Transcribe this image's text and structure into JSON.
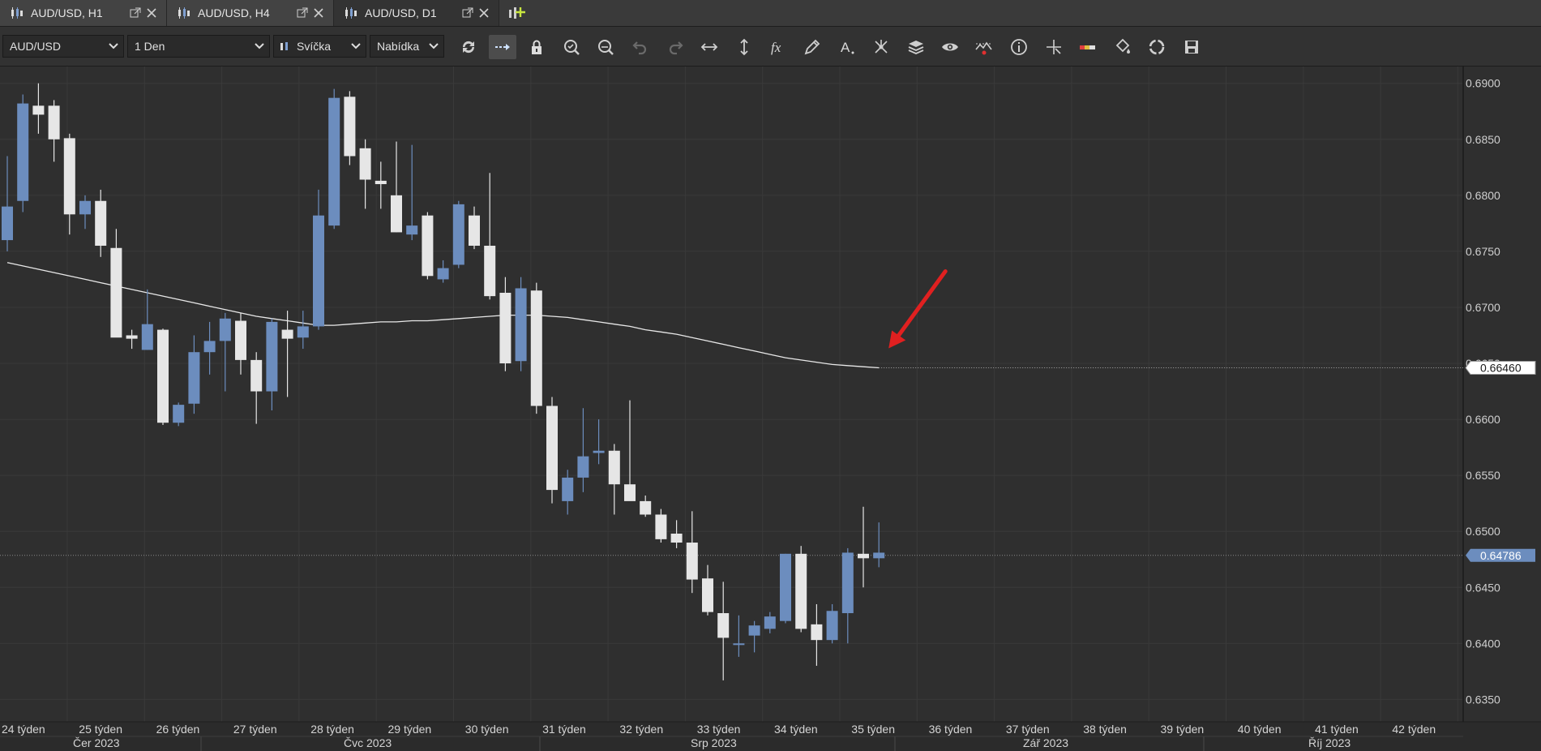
{
  "tabs": [
    {
      "label": "AUD/USD, H1",
      "active": false
    },
    {
      "label": "AUD/USD, H4",
      "active": false
    },
    {
      "label": "AUD/USD, D1",
      "active": true
    }
  ],
  "toolbar": {
    "symbol": "AUD/USD",
    "period": "1 Den",
    "chart_type": "Svíčka",
    "price_side": "Nabídka",
    "icons": [
      "refresh-icon",
      "autoscroll-icon",
      "lock-icon",
      "zoom-in-icon",
      "zoom-out-icon",
      "undo-icon",
      "redo-icon",
      "horizontal-arrows-icon",
      "vertical-arrows-icon",
      "indicators-fx-icon",
      "pencil-icon",
      "text-tool-icon",
      "pattern-icon",
      "layers-icon",
      "eye-icon",
      "alert-icon",
      "info-icon",
      "crosshair-icon",
      "color-bar-icon",
      "paint-bucket-icon",
      "reload-template-icon",
      "save-icon"
    ]
  },
  "colors": {
    "bull": "#6c8dbe",
    "bear": "#e6e6e6",
    "bg": "#2f2f2f",
    "grid": "#3a3a3a",
    "ma": "#e8e8e8",
    "arrow": "#e02020",
    "price_tag": "#6c8dbe"
  },
  "chart_data": {
    "type": "candlestick",
    "ylim": [
      0.633,
      0.6915
    ],
    "yticks": [
      "0.6900",
      "0.6850",
      "0.6800",
      "0.6750",
      "0.6700",
      "0.6650",
      "0.6600",
      "0.6550",
      "0.6500",
      "0.6450",
      "0.6400",
      "0.6350"
    ],
    "candles": [
      {
        "o": 0.676,
        "h": 0.6835,
        "l": 0.675,
        "c": 0.679
      },
      {
        "o": 0.6795,
        "h": 0.689,
        "l": 0.6785,
        "c": 0.6882
      },
      {
        "o": 0.688,
        "h": 0.69,
        "l": 0.6855,
        "c": 0.6872
      },
      {
        "o": 0.688,
        "h": 0.6885,
        "l": 0.683,
        "c": 0.685
      },
      {
        "o": 0.6851,
        "h": 0.6855,
        "l": 0.6765,
        "c": 0.6783
      },
      {
        "o": 0.6783,
        "h": 0.68,
        "l": 0.677,
        "c": 0.6795
      },
      {
        "o": 0.6795,
        "h": 0.6805,
        "l": 0.6745,
        "c": 0.6755
      },
      {
        "o": 0.6753,
        "h": 0.677,
        "l": 0.6705,
        "c": 0.6673
      },
      {
        "o": 0.6675,
        "h": 0.668,
        "l": 0.6663,
        "c": 0.6672
      },
      {
        "o": 0.6662,
        "h": 0.6716,
        "l": 0.6662,
        "c": 0.6685
      },
      {
        "o": 0.668,
        "h": 0.6681,
        "l": 0.6595,
        "c": 0.6597
      },
      {
        "o": 0.6597,
        "h": 0.6615,
        "l": 0.6594,
        "c": 0.6613
      },
      {
        "o": 0.6614,
        "h": 0.6675,
        "l": 0.6605,
        "c": 0.666
      },
      {
        "o": 0.666,
        "h": 0.6687,
        "l": 0.664,
        "c": 0.667
      },
      {
        "o": 0.667,
        "h": 0.6695,
        "l": 0.6625,
        "c": 0.669
      },
      {
        "o": 0.6688,
        "h": 0.6695,
        "l": 0.664,
        "c": 0.6653
      },
      {
        "o": 0.6653,
        "h": 0.666,
        "l": 0.6596,
        "c": 0.6625
      },
      {
        "o": 0.6625,
        "h": 0.669,
        "l": 0.6608,
        "c": 0.6687
      },
      {
        "o": 0.668,
        "h": 0.6697,
        "l": 0.662,
        "c": 0.6672
      },
      {
        "o": 0.6673,
        "h": 0.6697,
        "l": 0.6663,
        "c": 0.6683
      },
      {
        "o": 0.6683,
        "h": 0.6805,
        "l": 0.668,
        "c": 0.6782
      },
      {
        "o": 0.6773,
        "h": 0.6895,
        "l": 0.677,
        "c": 0.6887
      },
      {
        "o": 0.6888,
        "h": 0.6893,
        "l": 0.6827,
        "c": 0.6835
      },
      {
        "o": 0.6842,
        "h": 0.685,
        "l": 0.6788,
        "c": 0.6814
      },
      {
        "o": 0.6813,
        "h": 0.683,
        "l": 0.6788,
        "c": 0.681
      },
      {
        "o": 0.68,
        "h": 0.6848,
        "l": 0.6767,
        "c": 0.6767
      },
      {
        "o": 0.6765,
        "h": 0.6845,
        "l": 0.676,
        "c": 0.6773
      },
      {
        "o": 0.6782,
        "h": 0.6785,
        "l": 0.6725,
        "c": 0.6728
      },
      {
        "o": 0.6725,
        "h": 0.6742,
        "l": 0.6722,
        "c": 0.6735
      },
      {
        "o": 0.6738,
        "h": 0.6795,
        "l": 0.6735,
        "c": 0.6792
      },
      {
        "o": 0.6782,
        "h": 0.679,
        "l": 0.6752,
        "c": 0.6755
      },
      {
        "o": 0.6755,
        "h": 0.682,
        "l": 0.6707,
        "c": 0.671
      },
      {
        "o": 0.6713,
        "h": 0.6727,
        "l": 0.6643,
        "c": 0.665
      },
      {
        "o": 0.6652,
        "h": 0.6727,
        "l": 0.6643,
        "c": 0.6717
      },
      {
        "o": 0.6715,
        "h": 0.6722,
        "l": 0.6605,
        "c": 0.6612
      },
      {
        "o": 0.6612,
        "h": 0.662,
        "l": 0.6525,
        "c": 0.6537
      },
      {
        "o": 0.6527,
        "h": 0.6555,
        "l": 0.6515,
        "c": 0.6548
      },
      {
        "o": 0.6548,
        "h": 0.661,
        "l": 0.6535,
        "c": 0.6567
      },
      {
        "o": 0.657,
        "h": 0.66,
        "l": 0.656,
        "c": 0.6572
      },
      {
        "o": 0.6572,
        "h": 0.6578,
        "l": 0.6515,
        "c": 0.6542
      },
      {
        "o": 0.6542,
        "h": 0.6617,
        "l": 0.6528,
        "c": 0.6527
      },
      {
        "o": 0.6527,
        "h": 0.6532,
        "l": 0.6513,
        "c": 0.6515
      },
      {
        "o": 0.6515,
        "h": 0.652,
        "l": 0.649,
        "c": 0.6493
      },
      {
        "o": 0.6498,
        "h": 0.651,
        "l": 0.6485,
        "c": 0.649
      },
      {
        "o": 0.649,
        "h": 0.6518,
        "l": 0.6445,
        "c": 0.6457
      },
      {
        "o": 0.6458,
        "h": 0.647,
        "l": 0.6425,
        "c": 0.6428
      },
      {
        "o": 0.6427,
        "h": 0.6455,
        "l": 0.6367,
        "c": 0.6405
      },
      {
        "o": 0.64,
        "h": 0.6425,
        "l": 0.6388,
        "c": 0.64
      },
      {
        "o": 0.6407,
        "h": 0.642,
        "l": 0.6392,
        "c": 0.6416
      },
      {
        "o": 0.6413,
        "h": 0.6428,
        "l": 0.6409,
        "c": 0.6424
      },
      {
        "o": 0.642,
        "h": 0.648,
        "l": 0.6418,
        "c": 0.648
      },
      {
        "o": 0.648,
        "h": 0.6487,
        "l": 0.641,
        "c": 0.6413
      },
      {
        "o": 0.6417,
        "h": 0.6435,
        "l": 0.638,
        "c": 0.6403
      },
      {
        "o": 0.6403,
        "h": 0.6435,
        "l": 0.64,
        "c": 0.6429
      },
      {
        "o": 0.6427,
        "h": 0.6485,
        "l": 0.64,
        "c": 0.6481
      },
      {
        "o": 0.648,
        "h": 0.6522,
        "l": 0.645,
        "c": 0.6476
      },
      {
        "o": 0.6476,
        "h": 0.6508,
        "l": 0.6468,
        "c": 0.6481
      }
    ],
    "ma": [
      0.674,
      0.6737,
      0.6734,
      0.6731,
      0.6728,
      0.6725,
      0.6722,
      0.6719,
      0.6716,
      0.6713,
      0.671,
      0.6707,
      0.6704,
      0.6701,
      0.6698,
      0.6695,
      0.6692,
      0.669,
      0.6688,
      0.6686,
      0.6684,
      0.6684,
      0.6685,
      0.6686,
      0.6687,
      0.6687,
      0.6688,
      0.6688,
      0.6689,
      0.669,
      0.6691,
      0.6692,
      0.6693,
      0.6693,
      0.6693,
      0.6692,
      0.6691,
      0.6689,
      0.6687,
      0.6685,
      0.6683,
      0.668,
      0.6678,
      0.6676,
      0.6673,
      0.667,
      0.6667,
      0.6664,
      0.6661,
      0.6658,
      0.6655,
      0.6653,
      0.6651,
      0.6649,
      0.6648,
      0.6647,
      0.6646
    ],
    "current_price": "0.64786",
    "ma_value": "0.66460",
    "week_labels": [
      "24 týden",
      "25 týden",
      "26 týden",
      "27 týden",
      "28 týden",
      "29 týden",
      "30 týden",
      "31 týden",
      "32 týden",
      "33 týden",
      "34 týden",
      "35 týden",
      "36 týden",
      "37 týden",
      "38 týden",
      "39 týden",
      "40 týden",
      "41 týden",
      "42 týden"
    ],
    "month_labels": [
      "Čer 2023",
      "Čvc 2023",
      "Srp 2023",
      "Zář 2023",
      "Říj 2023"
    ],
    "grid": true
  }
}
